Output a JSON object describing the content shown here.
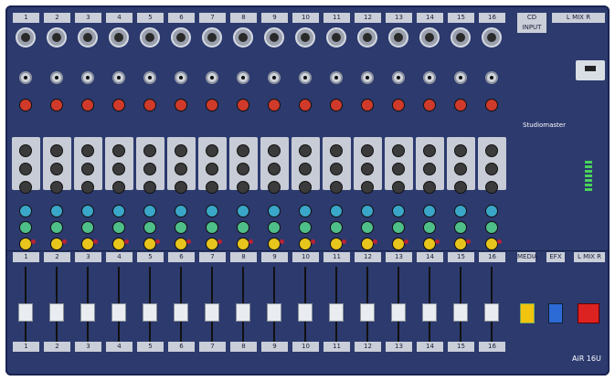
{
  "channels": [
    "1",
    "2",
    "3",
    "4",
    "5",
    "6",
    "7",
    "8",
    "9",
    "10",
    "11",
    "12",
    "13",
    "14",
    "15",
    "16"
  ],
  "master": {
    "top_cd_label": "CD INPUT",
    "top_mix_l": "L",
    "top_mix_r": "R",
    "top_mix": "MIX",
    "brand": "Studiomaster",
    "media_label": "MEDIA",
    "efx_label": "EFX",
    "mix_bottom": "L MIX R",
    "model": "AiR 16U"
  }
}
